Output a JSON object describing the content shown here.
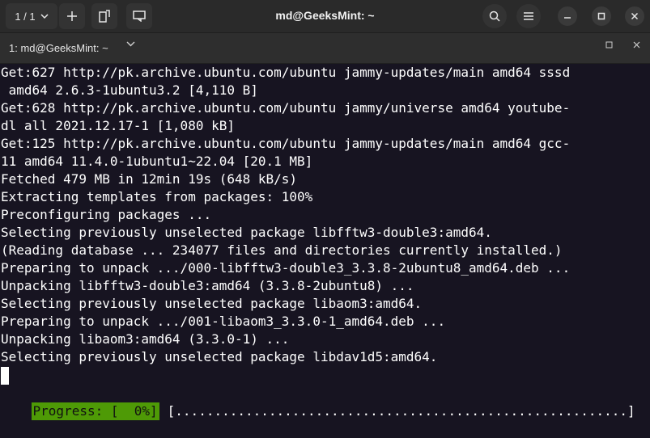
{
  "titlebar": {
    "tab_selector": "1 / 1",
    "title": "md@GeeksMint: ~"
  },
  "tabbar": {
    "label": "1: md@GeeksMint: ~"
  },
  "terminal": {
    "lines": [
      "Get:627 http://pk.archive.ubuntu.com/ubuntu jammy-updates/main amd64 sssd",
      " amd64 2.6.3-1ubuntu3.2 [4,110 B]",
      "Get:628 http://pk.archive.ubuntu.com/ubuntu jammy/universe amd64 youtube-",
      "dl all 2021.12.17-1 [1,080 kB]",
      "Get:125 http://pk.archive.ubuntu.com/ubuntu jammy-updates/main amd64 gcc-",
      "11 amd64 11.4.0-1ubuntu1~22.04 [20.1 MB]",
      "Fetched 479 MB in 12min 19s (648 kB/s)",
      "Extracting templates from packages: 100%",
      "Preconfiguring packages ...",
      "Selecting previously unselected package libfftw3-double3:amd64.",
      "(Reading database ... 234077 files and directories currently installed.)",
      "Preparing to unpack .../000-libfftw3-double3_3.3.8-2ubuntu8_amd64.deb ...",
      "Unpacking libfftw3-double3:amd64 (3.3.8-2ubuntu8) ...",
      "Selecting previously unselected package libaom3:amd64.",
      "Preparing to unpack .../001-libaom3_3.3.0-1_amd64.deb ...",
      "Unpacking libaom3:amd64 (3.3.0-1) ...",
      "Selecting previously unselected package libdav1d5:amd64."
    ],
    "progress_label": "Progress: [  0%]",
    "progress_bar": "[..........................................................]",
    "progress_percent": 0
  },
  "colors": {
    "background": "#171421",
    "progress": "#4e9a06"
  }
}
